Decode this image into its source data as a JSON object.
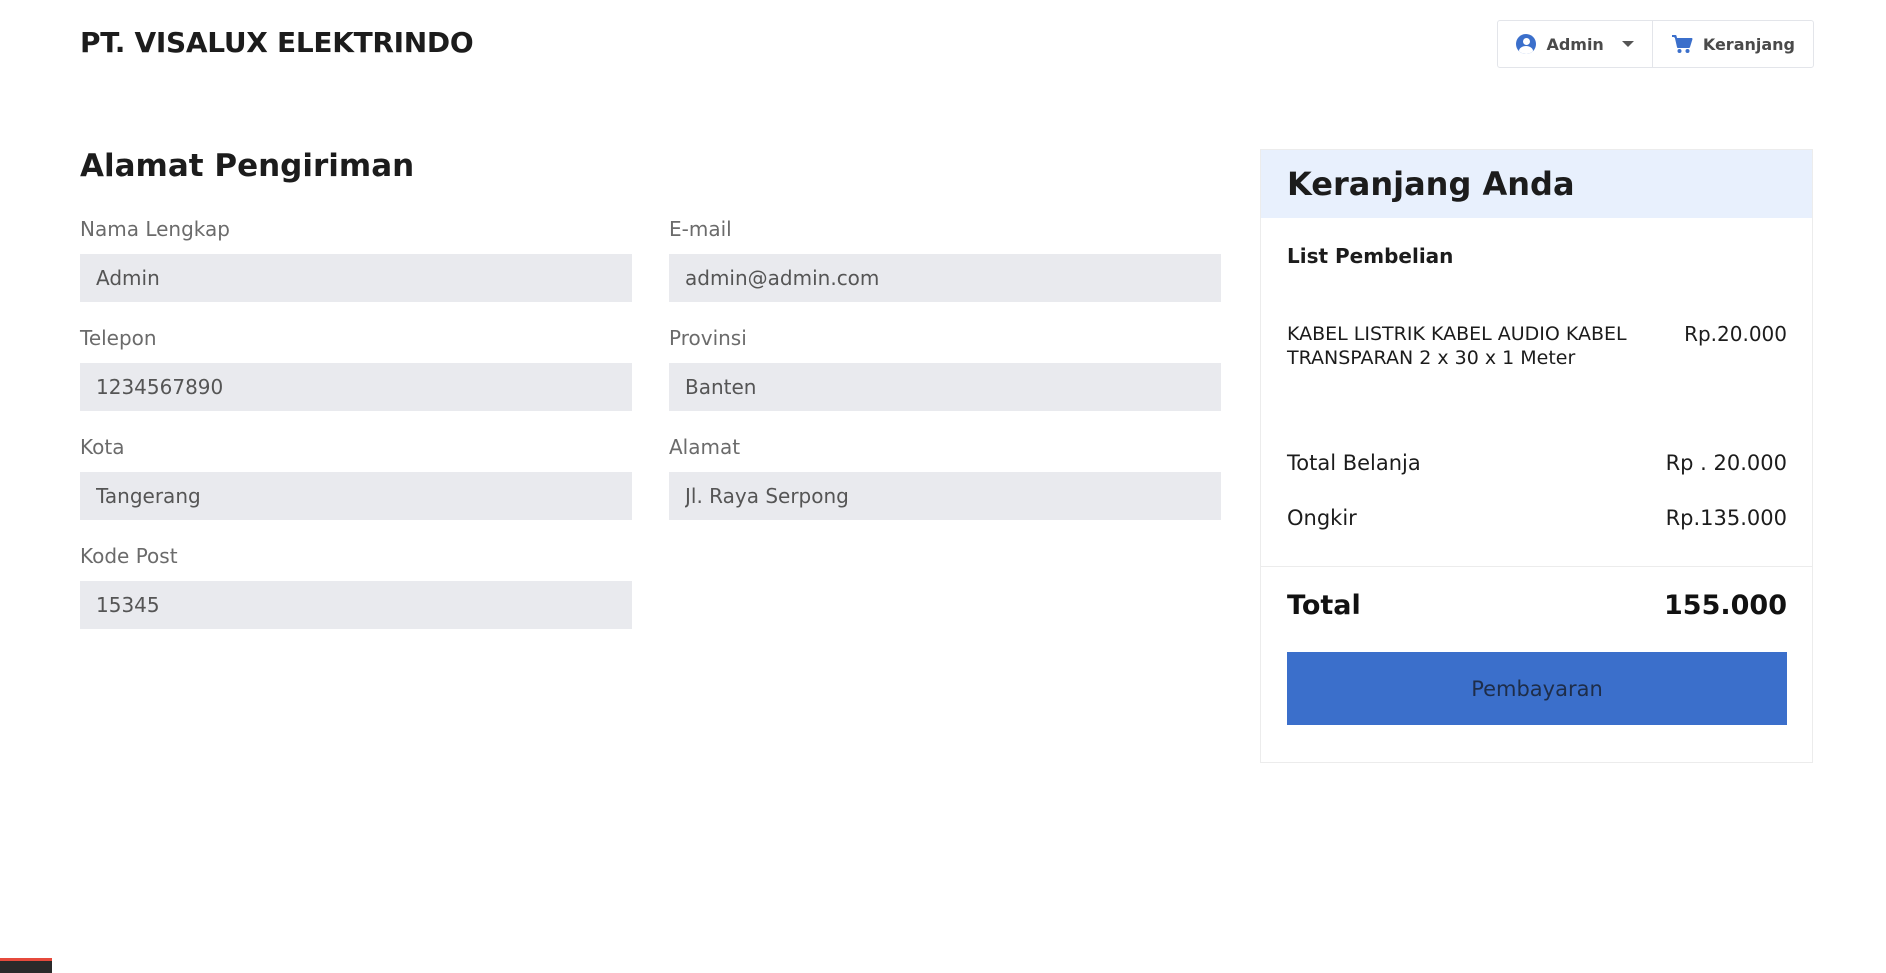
{
  "header": {
    "brand": "PT. VISALUX ELEKTRINDO",
    "user_label": "Admin",
    "cart_label": "Keranjang"
  },
  "shipping": {
    "title": "Alamat Pengiriman",
    "fields": [
      {
        "label": "Nama Lengkap",
        "value": "Admin"
      },
      {
        "label": "E-mail",
        "value": "admin@admin.com"
      },
      {
        "label": "Telepon",
        "value": "1234567890"
      },
      {
        "label": "Provinsi",
        "value": "Banten"
      },
      {
        "label": "Kota",
        "value": "Tangerang"
      },
      {
        "label": "Alamat",
        "value": "Jl. Raya Serpong"
      },
      {
        "label": "Kode Post",
        "value": "15345"
      }
    ]
  },
  "cart": {
    "title": "Keranjang Anda",
    "list_title": "List Pembelian",
    "items": [
      {
        "name": "KABEL LISTRIK KABEL AUDIO KABEL TRANSPARAN 2 x 30 x 1 Meter",
        "price": "Rp.20.000"
      }
    ],
    "subtotal_label": "Total Belanja",
    "subtotal_value": "Rp . 20.000",
    "shipping_label": "Ongkir",
    "shipping_value": "Rp.135.000",
    "total_label": "Total",
    "total_value": "155.000",
    "pay_label": "Pembayaran"
  },
  "colors": {
    "accent": "#3b6fcb",
    "card_header_bg": "#e8f0fd",
    "input_bg": "#e9eaee"
  }
}
